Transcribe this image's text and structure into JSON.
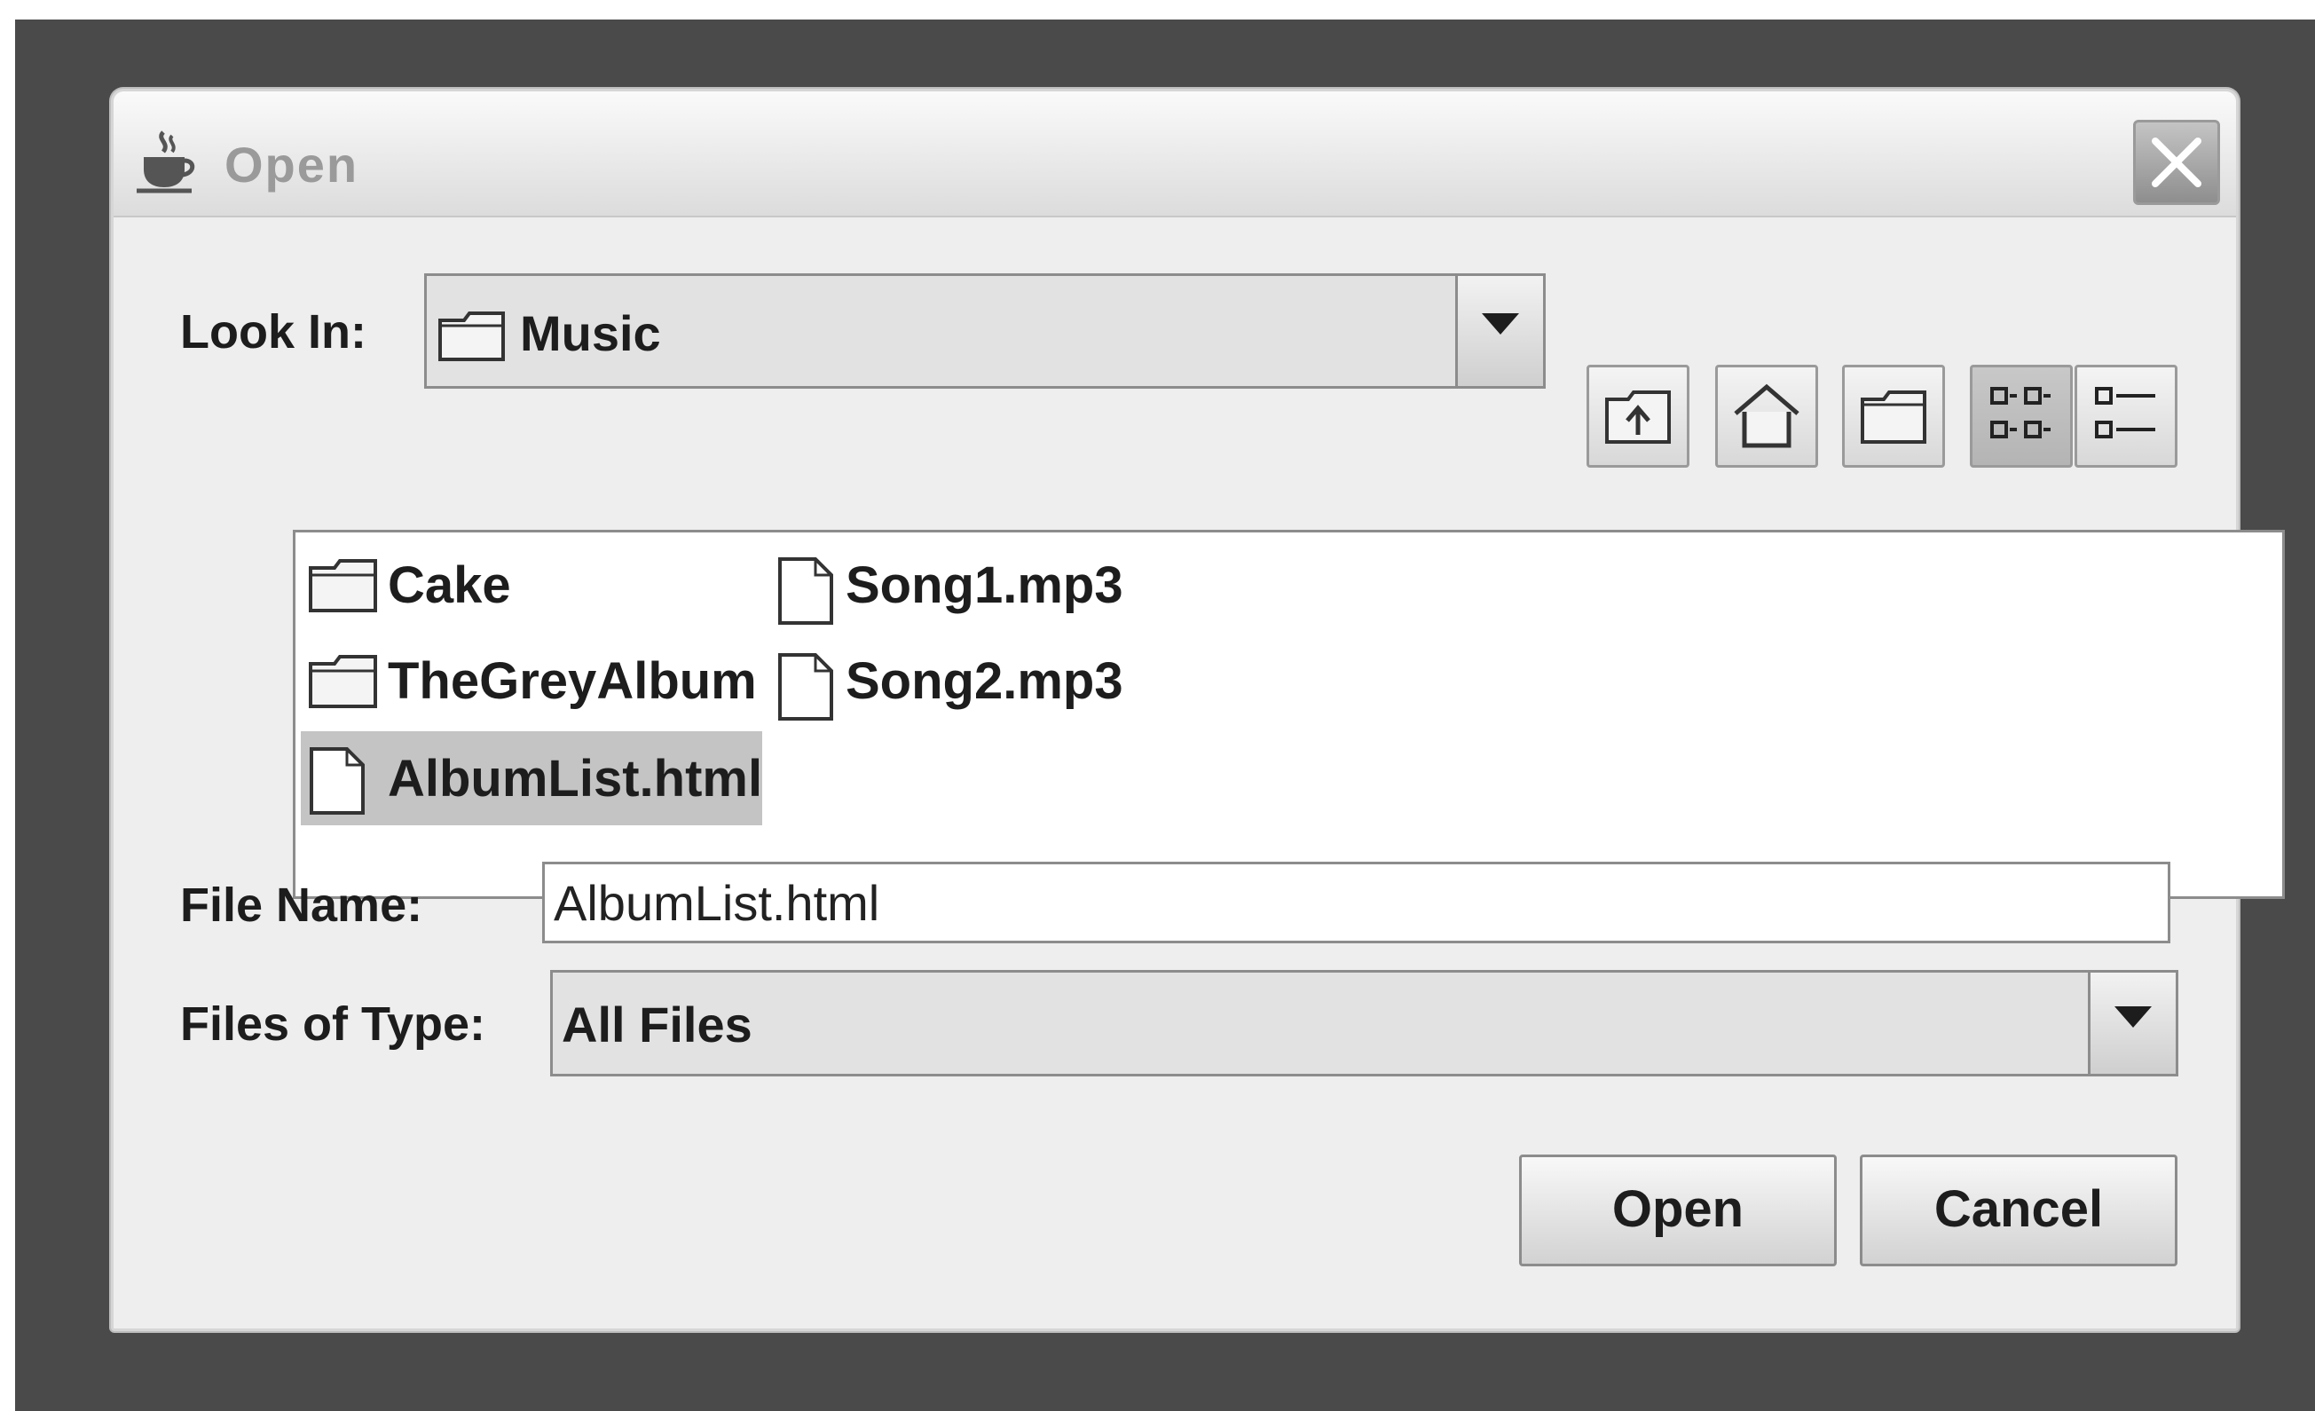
{
  "window": {
    "title": "Open",
    "title_icon": "java-coffee-cup-icon",
    "close_icon": "close-icon"
  },
  "look_in": {
    "label": "Look In:",
    "value": "Music",
    "value_icon": "folder-icon",
    "toolbar": [
      {
        "icon": "up-one-level-icon"
      },
      {
        "icon": "home-icon"
      },
      {
        "icon": "new-folder-icon"
      },
      {
        "icon": "list-view-icon",
        "pressed": true
      },
      {
        "icon": "details-view-icon"
      }
    ]
  },
  "files": [
    {
      "name": "Cake",
      "type": "folder"
    },
    {
      "name": "TheGreyAlbum",
      "type": "folder"
    },
    {
      "name": "AlbumList.html",
      "type": "file",
      "selected": true
    },
    {
      "name": "Song1.mp3",
      "type": "file"
    },
    {
      "name": "Song2.mp3",
      "type": "file"
    }
  ],
  "file_name": {
    "label": "File Name:",
    "value": "AlbumList.html"
  },
  "files_of_type": {
    "label": "Files of Type:",
    "value": "All Files"
  },
  "buttons": {
    "open": "Open",
    "cancel": "Cancel"
  }
}
